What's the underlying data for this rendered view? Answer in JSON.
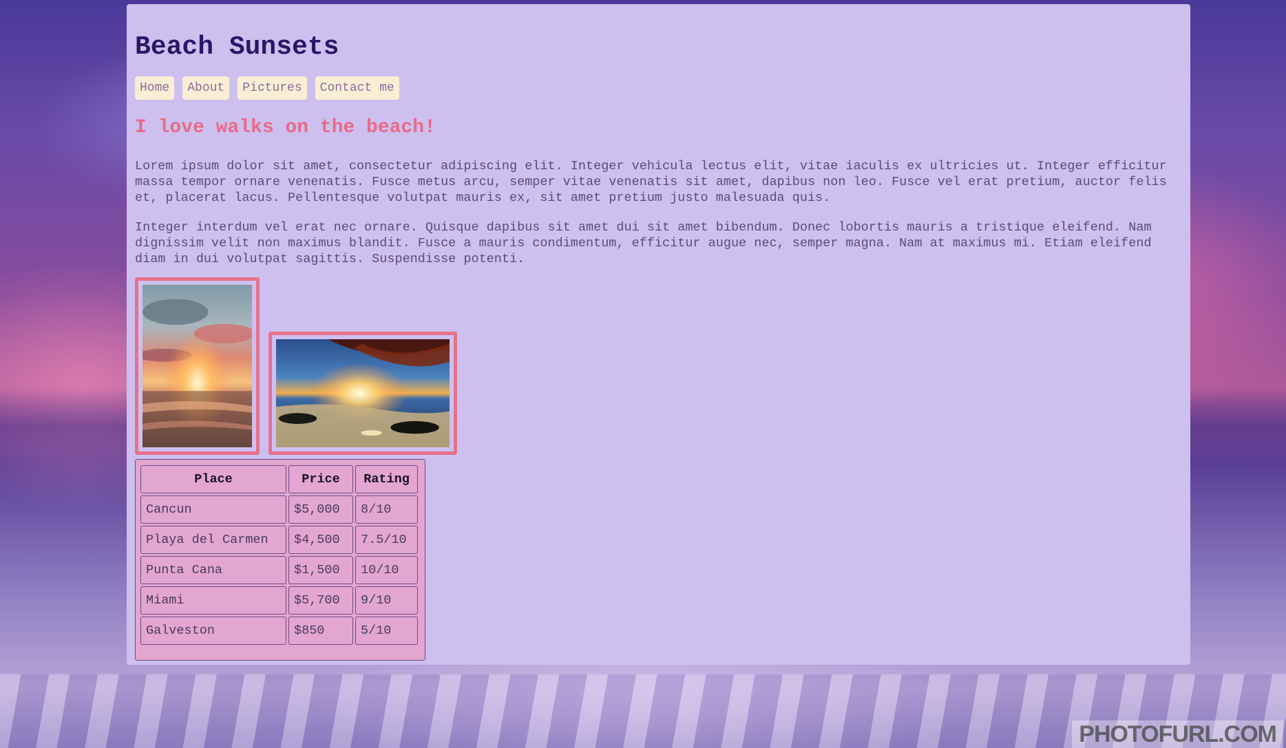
{
  "site": {
    "title": "Beach Sunsets"
  },
  "nav": {
    "items": [
      {
        "label": "Home"
      },
      {
        "label": "About"
      },
      {
        "label": "Pictures"
      },
      {
        "label": "Contact me"
      }
    ]
  },
  "main": {
    "headline": "I love walks on the beach!",
    "paragraphs": [
      "Lorem ipsum dolor sit amet, consectetur adipiscing elit. Integer vehicula lectus elit, vitae iaculis ex ultricies ut. Integer efficitur massa tempor ornare venenatis. Fusce metus arcu, semper vitae venenatis sit amet, dapibus non leo. Fusce vel erat pretium, auctor felis et, placerat lacus. Pellentesque volutpat mauris ex, sit amet pretium justo malesuada quis.",
      "Integer interdum vel erat nec ornare. Quisque dapibus sit amet dui sit amet bibendum. Donec lobortis mauris a tristique eleifend. Nam dignissim velit non maximus blandit. Fusce a mauris condimentum, efficitur augue nec, semper magna. Nam at maximus mi. Etiam eleifend diam in dui volutpat sagittis. Suspendisse potenti."
    ]
  },
  "table": {
    "headers": [
      "Place",
      "Price",
      "Rating"
    ],
    "rows": [
      [
        "Cancun",
        "$5,000",
        "8/10"
      ],
      [
        "Playa del Carmen",
        "$4,500",
        "7.5/10"
      ],
      [
        "Punta Cana",
        "$1,500",
        "10/10"
      ],
      [
        "Miami",
        "$5,700",
        "9/10"
      ],
      [
        "Galveston",
        "$850",
        "5/10"
      ]
    ]
  },
  "watermark": {
    "text": "PHOTOFURL.COM"
  },
  "colors": {
    "panel": "#cdc0ef",
    "title": "#2b1766",
    "headline": "#e86a88",
    "nav_bg": "#fbeed5",
    "nav_text": "#8a6d9a",
    "photo_border": "#e5718a",
    "table_bg": "#e3a6d1",
    "body_text": "#5c4a7a"
  }
}
